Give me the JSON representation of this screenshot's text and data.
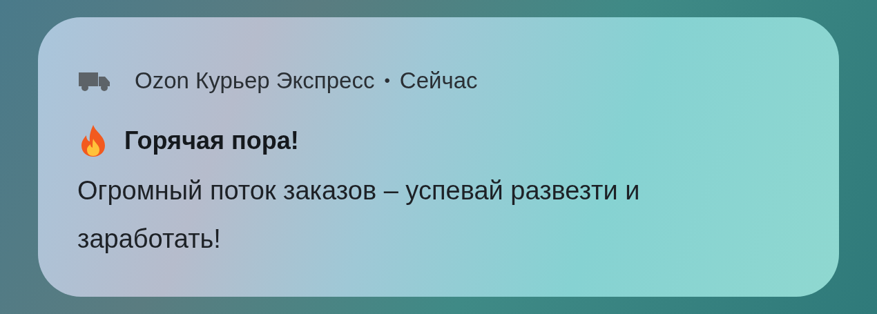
{
  "notification": {
    "app_name": "Ozon Курьер Экспресс",
    "separator": "•",
    "time": "Сейчас",
    "title": "Горячая пора!",
    "body": "Огромный поток заказов – успевай развезти и заработать!"
  }
}
